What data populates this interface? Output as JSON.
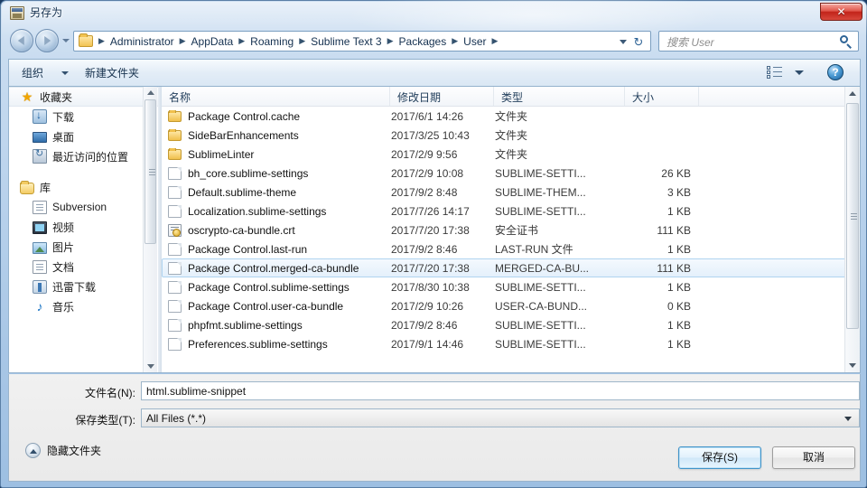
{
  "window": {
    "title": "另存为",
    "title_icon": "window-icon",
    "close_label": "✕"
  },
  "address": {
    "back_icon": "back-arrow-icon",
    "forward_icon": "forward-arrow-icon",
    "history_caret_icon": "chevron-down-icon",
    "folder_icon": "folder-icon",
    "separator": "▶",
    "breadcrumbs": [
      "Administrator",
      "AppData",
      "Roaming",
      "Sublime Text 3",
      "Packages",
      "User"
    ],
    "dropdown_icon": "chevron-down-icon",
    "refresh_icon": "refresh-icon",
    "refresh_glyph": "↻"
  },
  "search": {
    "placeholder": "搜索 User",
    "icon": "search-icon"
  },
  "toolbar": {
    "organize_label": "组织",
    "organize_caret_icon": "chevron-down-icon",
    "new_folder_label": "新建文件夹",
    "view_icon": "view-list-icon",
    "view_caret_icon": "chevron-down-icon",
    "help_icon": "help-icon",
    "help_glyph": "?"
  },
  "sidebar": {
    "items": [
      {
        "label": "收藏夹",
        "icon": "star-icon",
        "level": 0,
        "selected": true
      },
      {
        "label": "下载",
        "icon": "downloads-icon",
        "level": 1,
        "selected": false
      },
      {
        "label": "桌面",
        "icon": "desktop-icon",
        "level": 1,
        "selected": false
      },
      {
        "label": "最近访问的位置",
        "icon": "recent-places-icon",
        "level": 1,
        "selected": false
      },
      {
        "label": "库",
        "icon": "library-icon",
        "level": 0,
        "selected": false
      },
      {
        "label": "Subversion",
        "icon": "subversion-icon",
        "level": 1,
        "selected": false
      },
      {
        "label": "视频",
        "icon": "video-icon",
        "level": 1,
        "selected": false
      },
      {
        "label": "图片",
        "icon": "picture-icon",
        "level": 1,
        "selected": false
      },
      {
        "label": "文档",
        "icon": "document-icon",
        "level": 1,
        "selected": false
      },
      {
        "label": "迅雷下载",
        "icon": "thunder-download-icon",
        "level": 1,
        "selected": false
      },
      {
        "label": "音乐",
        "icon": "music-icon",
        "level": 1,
        "selected": false
      }
    ],
    "scroll_up_icon": "scroll-up-icon",
    "scroll_down_icon": "scroll-down-icon"
  },
  "filelist": {
    "columns": [
      "名称",
      "修改日期",
      "类型",
      "大小"
    ],
    "sorted_column": "名称",
    "sort_caret_icon": "sort-ascending-icon",
    "rows": [
      {
        "name": "Package Control.cache",
        "date": "2017/6/1 14:26",
        "type": "文件夹",
        "size": "",
        "icon": "folder-icon",
        "selected": false
      },
      {
        "name": "SideBarEnhancements",
        "date": "2017/3/25 10:43",
        "type": "文件夹",
        "size": "",
        "icon": "folder-icon",
        "selected": false
      },
      {
        "name": "SublimeLinter",
        "date": "2017/2/9 9:56",
        "type": "文件夹",
        "size": "",
        "icon": "folder-icon",
        "selected": false
      },
      {
        "name": "bh_core.sublime-settings",
        "date": "2017/2/9 10:08",
        "type": "SUBLIME-SETTI...",
        "size": "26 KB",
        "icon": "file-icon",
        "selected": false
      },
      {
        "name": "Default.sublime-theme",
        "date": "2017/9/2 8:48",
        "type": "SUBLIME-THEM...",
        "size": "3 KB",
        "icon": "file-icon",
        "selected": false
      },
      {
        "name": "Localization.sublime-settings",
        "date": "2017/7/26 14:17",
        "type": "SUBLIME-SETTI...",
        "size": "1 KB",
        "icon": "file-icon",
        "selected": false
      },
      {
        "name": "oscrypto-ca-bundle.crt",
        "date": "2017/7/20 17:38",
        "type": "安全证书",
        "size": "111 KB",
        "icon": "certificate-icon",
        "selected": false
      },
      {
        "name": "Package Control.last-run",
        "date": "2017/9/2 8:46",
        "type": "LAST-RUN 文件",
        "size": "1 KB",
        "icon": "file-icon",
        "selected": false
      },
      {
        "name": "Package Control.merged-ca-bundle",
        "date": "2017/7/20 17:38",
        "type": "MERGED-CA-BU...",
        "size": "111 KB",
        "icon": "file-icon",
        "selected": true
      },
      {
        "name": "Package Control.sublime-settings",
        "date": "2017/8/30 10:38",
        "type": "SUBLIME-SETTI...",
        "size": "1 KB",
        "icon": "file-icon",
        "selected": false
      },
      {
        "name": "Package Control.user-ca-bundle",
        "date": "2017/2/9 10:26",
        "type": "USER-CA-BUND...",
        "size": "0 KB",
        "icon": "file-icon",
        "selected": false
      },
      {
        "name": "phpfmt.sublime-settings",
        "date": "2017/9/2 8:46",
        "type": "SUBLIME-SETTI...",
        "size": "1 KB",
        "icon": "file-icon",
        "selected": false
      },
      {
        "name": "Preferences.sublime-settings",
        "date": "2017/9/1 14:46",
        "type": "SUBLIME-SETTI...",
        "size": "1 KB",
        "icon": "file-icon",
        "selected": false
      }
    ],
    "scroll_up_icon": "scroll-up-icon",
    "scroll_down_icon": "scroll-down-icon"
  },
  "form": {
    "filename_label": "文件名(N):",
    "filename_value": "html.sublime-snippet",
    "savetype_label": "保存类型(T):",
    "savetype_value": "All Files (*.*)",
    "savetype_caret_icon": "chevron-down-icon",
    "hide_folders_label": "隐藏文件夹",
    "hide_folders_icon": "chevron-up-circle-icon",
    "save_button": "保存(S)",
    "cancel_button": "取消"
  },
  "colors": {
    "accent": "#3f93c9",
    "close_red": "#c2231a",
    "folder_yellow": "#f0c04c",
    "selection_blue": "#e4f0fb",
    "frame_blue": "#94b2cd"
  }
}
